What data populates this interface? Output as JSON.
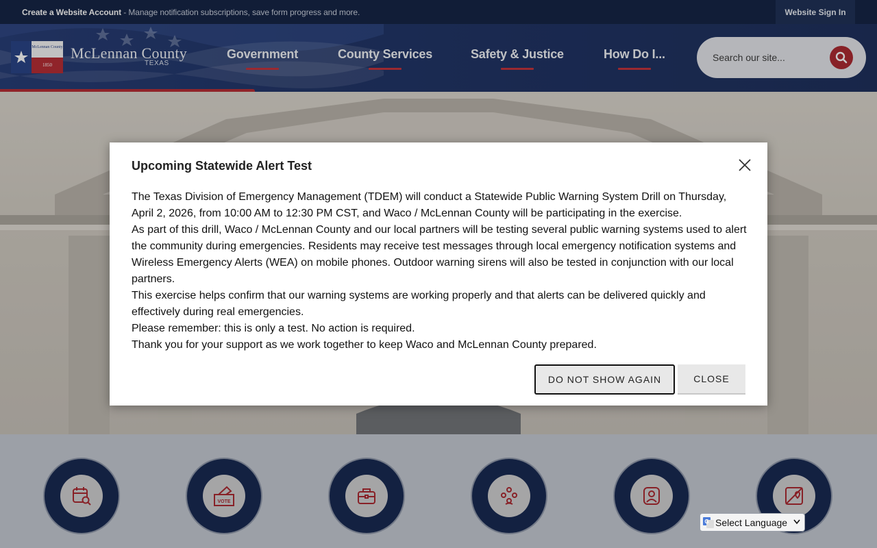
{
  "topbar": {
    "account_link": "Create a Website Account",
    "account_desc": " - Manage notification subscriptions, save form progress and more.",
    "signin": "Website Sign In"
  },
  "header": {
    "brand": "McLennan County",
    "brand_sub": "TEXAS",
    "logo_text_top": "McLennan County",
    "logo_year": "1850",
    "nav": [
      {
        "label": "Government"
      },
      {
        "label": "County Services"
      },
      {
        "label": "Safety & Justice"
      },
      {
        "label": "How Do I..."
      }
    ],
    "search_placeholder": "Search our site..."
  },
  "modal": {
    "title": "Upcoming Statewide Alert Test",
    "paragraphs": [
      "The Texas Division of Emergency Management (TDEM) will conduct a Statewide Public Warning System Drill on Thursday, April 2, 2026, from 10:00 AM to 12:30 PM CST, and Waco / McLennan County will be participating in the exercise.",
      "As part of this drill, Waco / McLennan County and our local partners will be testing several public warning systems used to alert the community during emergencies. Residents may receive test messages through local emergency notification systems and Wireless Emergency Alerts (WEA) on mobile phones. Outdoor warning sirens will also be tested in conjunction with our local partners.",
      "This exercise helps confirm that our warning systems are working properly and that alerts can be delivered quickly and effectively during real emergencies.",
      "Please remember: this is only a test. No action is required.",
      "Thank you for your support as we work together to keep Waco and McLennan County prepared."
    ],
    "btn_dont_show": "DO NOT SHOW AGAIN",
    "btn_close": "CLOSE"
  },
  "quick_links": [
    {
      "icon": "calendar-search-icon"
    },
    {
      "icon": "vote-ballot-icon",
      "badge": "VOTE"
    },
    {
      "icon": "briefcase-icon"
    },
    {
      "icon": "people-group-icon"
    },
    {
      "icon": "person-portrait-icon"
    },
    {
      "icon": "map-pin-icon"
    }
  ],
  "language": {
    "label": "Select Language"
  },
  "colors": {
    "navy": "#0d1f4a",
    "red": "#a81f27",
    "header": "#172c62"
  }
}
